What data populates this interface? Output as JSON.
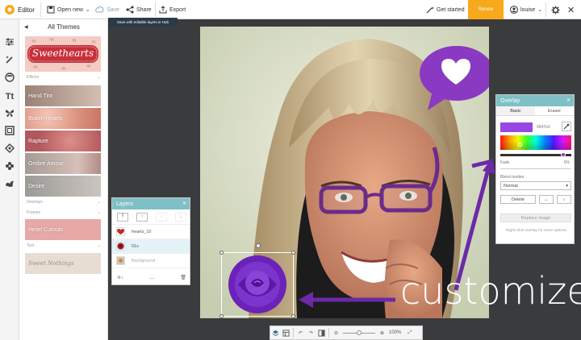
{
  "app": {
    "title": "Editor"
  },
  "toolbar": {
    "open_new": "Open new",
    "save": "Save",
    "share": "Share",
    "export": "Export",
    "save_tooltip": "Save with editable layers in Hub",
    "get_started": "Get started",
    "renew": "Renew",
    "user": "louise",
    "colors": {
      "accent": "#f8a81b"
    }
  },
  "themes_panel": {
    "title": "All Themes",
    "featured": "Sweethearts",
    "sections": {
      "effects": "Effects",
      "overlays": "Overlays",
      "frames": "Frames",
      "text": "Text"
    },
    "effects": [
      "Hand Tint",
      "Bokeh Hearts",
      "Rapture",
      "Ombre Amour",
      "Desire"
    ],
    "frames": [
      "Heart Cutouts"
    ],
    "text": [
      "Sweet Nothings"
    ]
  },
  "layers_panel": {
    "title": "Layers",
    "items": [
      {
        "name": "hearts_10",
        "selected": false
      },
      {
        "name": "01x",
        "selected": true
      },
      {
        "name": "Background",
        "selected": false
      }
    ],
    "more": "...."
  },
  "overlay_panel": {
    "title": "Overlay",
    "tabs": [
      "Basic",
      "Eraser"
    ],
    "hex": "9947e3",
    "fade_label": "Fade",
    "fade_value": "0%",
    "blend_label": "Blend modes:",
    "blend_value": "Normal",
    "delete": "Delete",
    "replace": "Replace image",
    "hint": "Right-click overlay for more options.",
    "colors": {
      "swatch": "#9947e3"
    }
  },
  "canvas": {
    "caption": "customize"
  },
  "bottom_bar": {
    "zoom": "100%"
  }
}
